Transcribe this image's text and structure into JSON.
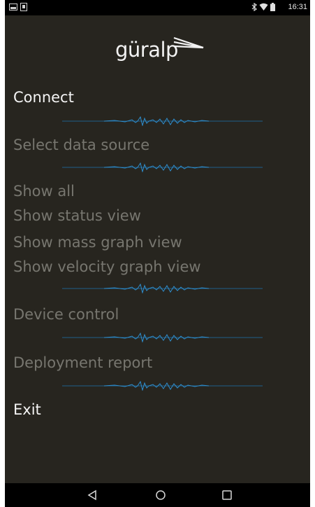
{
  "status_bar": {
    "time": "16:31",
    "left_icons": [
      "screenshot-icon",
      "sd-card-icon"
    ],
    "right_icons": [
      "bluetooth-icon",
      "wifi-icon",
      "battery-icon"
    ]
  },
  "logo": {
    "text": "güralp"
  },
  "menu": {
    "connect": "Connect",
    "select_data_source": "Select data source",
    "show_all": "Show all",
    "show_status_view": "Show status view",
    "show_mass_graph_view": "Show mass graph view",
    "show_velocity_graph_view": "Show velocity graph view",
    "device_control": "Device control",
    "deployment_report": "Deployment report",
    "exit": "Exit"
  },
  "colors": {
    "background": "#27251f",
    "active_text": "#f4f4f4",
    "disabled_text": "#77766f",
    "divider_line": "#1f5f8b",
    "divider_wave": "#2f8fcf"
  },
  "nav_bar": {
    "icons": [
      "back-icon",
      "home-icon",
      "recents-icon"
    ]
  }
}
